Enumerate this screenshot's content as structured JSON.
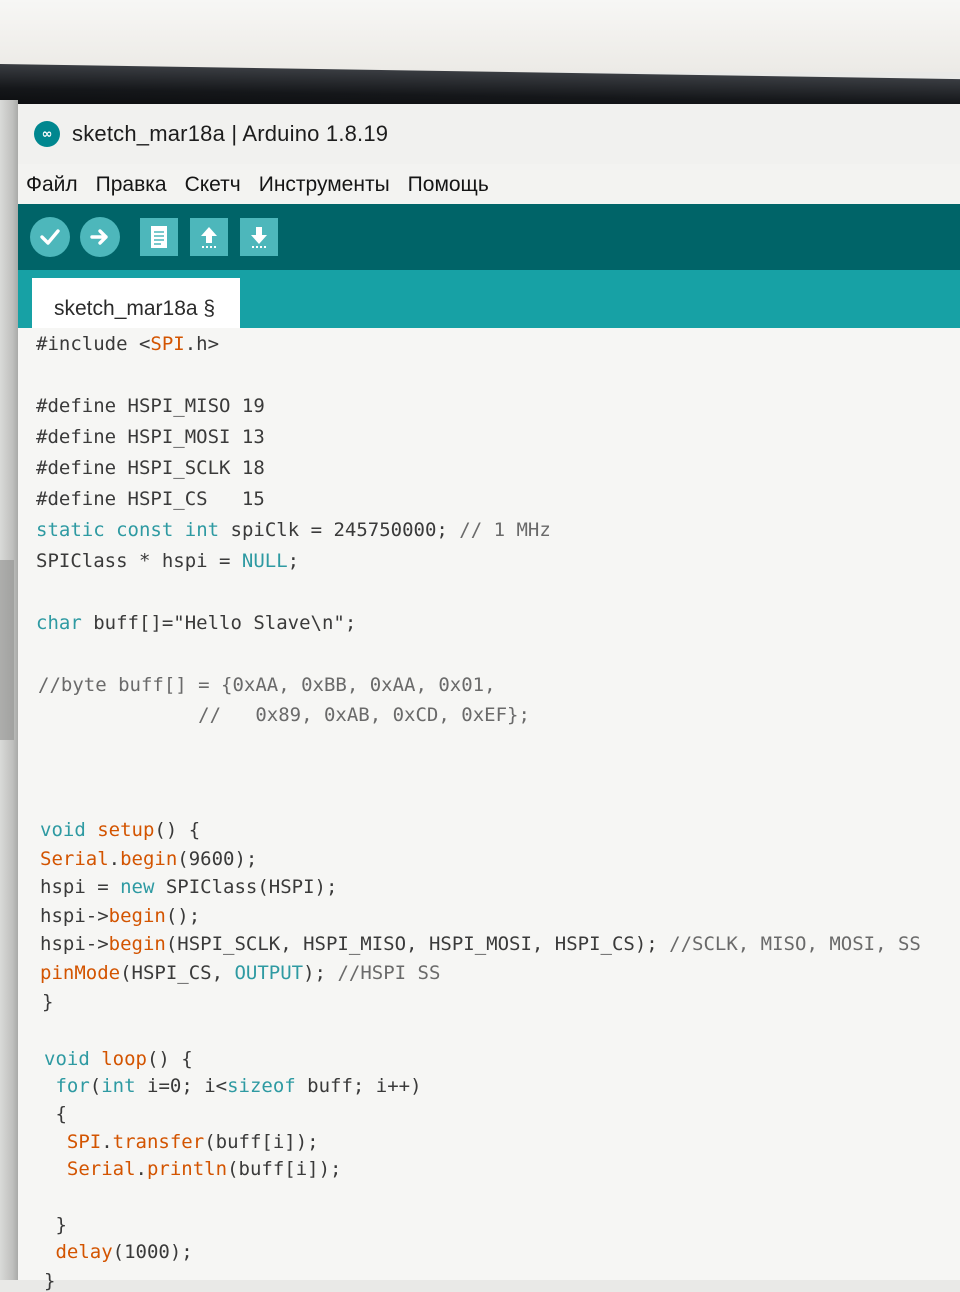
{
  "window": {
    "title": "sketch_mar18a | Arduino 1.8.19",
    "icon": "arduino-logo-icon"
  },
  "menu": {
    "items": [
      "Файл",
      "Правка",
      "Скетч",
      "Инструменты",
      "Помощь"
    ]
  },
  "toolbar": {
    "buttons": [
      "verify-icon",
      "upload-icon",
      "new-icon",
      "open-icon",
      "save-icon"
    ]
  },
  "tab": {
    "label": "sketch_mar18a §"
  },
  "code": {
    "lines": [
      "#include <SPI.h>",
      "",
      "#define HSPI_MISO 19",
      "#define HSPI_MOSI 13",
      "#define HSPI_SCLK 18",
      "#define HSPI_CS   15",
      "static const int spiClk = 245750000; // 1 MHz",
      "SPIClass * hspi = NULL;",
      "",
      "char buff[]=\"Hello Slave\\n\";",
      "",
      "//byte buff[] = {0xAA, 0xBB, 0xAA, 0x01,",
      "              //   0x89, 0xAB, 0xCD, 0xEF};",
      "",
      "",
      "",
      "void setup() {",
      "Serial.begin(9600);",
      "hspi = new SPIClass(HSPI);",
      "hspi->begin();",
      "hspi->begin(HSPI_SCLK, HSPI_MISO, HSPI_MOSI, HSPI_CS); //SCLK, MISO, MOSI, SS",
      "pinMode(HSPI_CS, OUTPUT); //HSPI SS",
      "}",
      "",
      "void loop() {",
      " for(int i=0; i<sizeof buff; i++)",
      " {",
      "  SPI.transfer(buff[i]);",
      "  Serial.println(buff[i]);",
      "",
      " }",
      " delay(1000);",
      "}"
    ]
  },
  "colors": {
    "toolbar": "#006468",
    "tabbar": "#17a1a5",
    "button": "#4db7bb",
    "keyword": "#2e9aa2",
    "function": "#d35400",
    "editor_bg": "#f6f6f4"
  }
}
